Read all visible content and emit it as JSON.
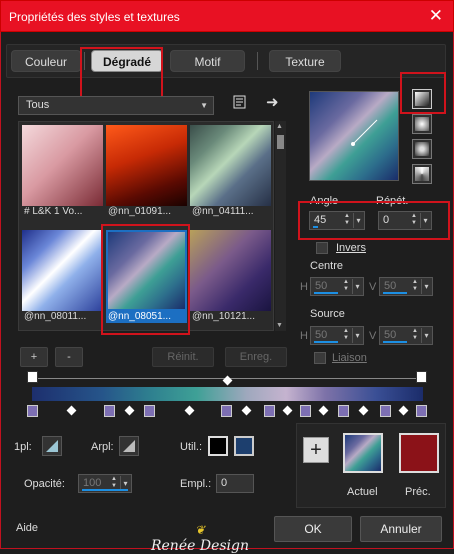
{
  "window": {
    "title": "Propriétés des styles et textures",
    "close_glyph": "✕"
  },
  "tabs": [
    "Couleur",
    "Dégradé",
    "Motif",
    "Texture"
  ],
  "library": {
    "dropdown_value": "Tous",
    "thumbnails": [
      {
        "label": "# L&K 1 Vo..."
      },
      {
        "label": "@nn_01091..."
      },
      {
        "label": "@nn_04111..."
      },
      {
        "label": "@nn_08011..."
      },
      {
        "label": "@nn_08051..."
      },
      {
        "label": "@nn_10121..."
      }
    ]
  },
  "buttons": {
    "add": "+",
    "remove": "-",
    "reset": "Réinit.",
    "save": "Enreg.",
    "ok": "OK",
    "cancel": "Annuler",
    "help": "Aide"
  },
  "params": {
    "angle_label": "Angle",
    "angle_value": "45",
    "repeat_label": "Répét.",
    "repeat_value": "0",
    "invert_label": "Invers",
    "center_label": "Centre",
    "source_label": "Source",
    "h_label": "H",
    "v_label": "V",
    "center_h": "50",
    "center_v": "50",
    "source_h": "50",
    "source_v": "50",
    "link_label": "Liaison"
  },
  "bottom": {
    "plan_label": "1pl:",
    "arpl_label": "Arpl:",
    "util_label": "Util.:",
    "opacity_label": "Opacité:",
    "opacity_value": "100",
    "empl_label": "Empl.:",
    "empl_value": "0",
    "current_label": "Actuel",
    "previous_label": "Préc.",
    "plus_glyph": "+"
  },
  "colors": {
    "titlebar": "#e81123",
    "highlight": "#d0131c",
    "selection": "#1c6fc2",
    "util_fore": "#000000",
    "util_back": "#1d3f6e",
    "previous_swatch": "#8b1218"
  },
  "watermark": "Renée Design"
}
